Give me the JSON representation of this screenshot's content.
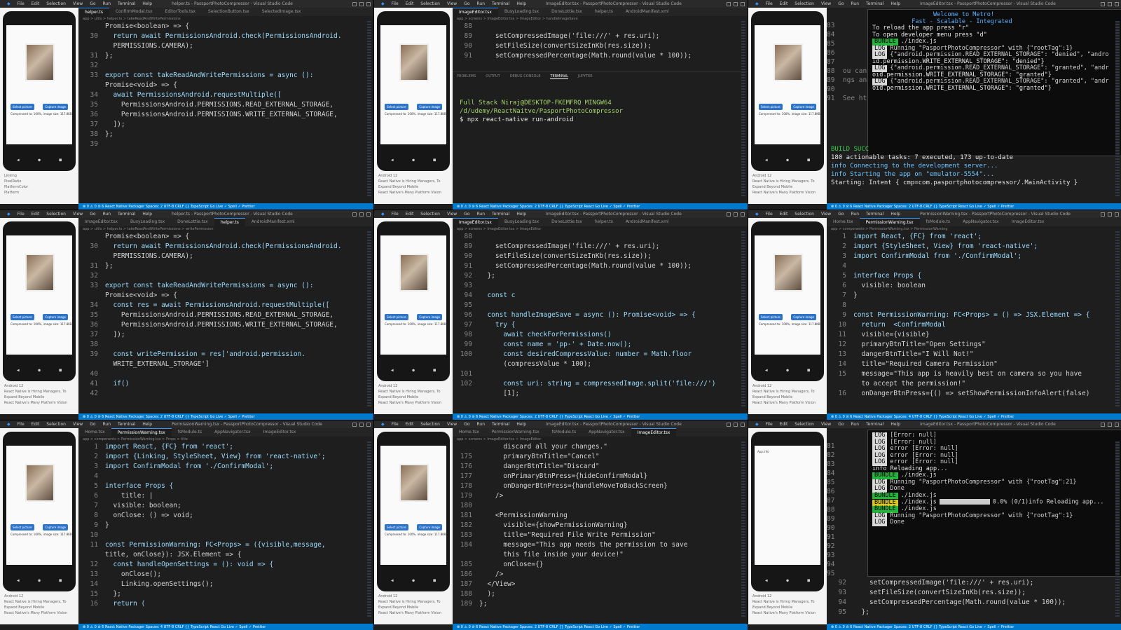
{
  "menu": [
    "File",
    "Edit",
    "Selection",
    "View",
    "Go",
    "Run",
    "Terminal",
    "Help"
  ],
  "phone": {
    "btn_left": "Select picture",
    "btn_right": "Capture image",
    "caption": "Compressed to: 100%, image size: 117.8KB",
    "nav": [
      "◀",
      "●",
      "■"
    ],
    "device_label": "Android 12",
    "notes_a": [
      "Linking",
      "PixelRatio",
      "PlatformColor",
      "Platform"
    ],
    "notes_b": [
      "React Native is Hiring Managers, To",
      "Expand Beyond Mobile",
      "React Native's Many Platform Vision"
    ]
  },
  "panes": [
    {
      "title": "helper.ts - PassportPhotoCompressor - Visual Studio Code",
      "tabs": [
        "helper.ts",
        "ConfirmModal.tsx",
        "EditorTools.tsx",
        "SelectionButton.tsx",
        "SelectedImage.tsx"
      ],
      "active": 0,
      "crumb": "app > utils > helper.ts > takeReadAndWritePermissions",
      "lines": [
        {
          "n": "",
          "t": "Promise<boolean> => {"
        },
        {
          "n": "30",
          "t": "  return await PermissionsAndroid.check(PermissionsAndroid."
        },
        {
          "n": "",
          "t": "  PERMISSIONS.CAMERA);"
        },
        {
          "n": "31",
          "t": "};"
        },
        {
          "n": "32",
          "t": ""
        },
        {
          "n": "33",
          "t": "export const takeReadAndWritePermissions = async ():"
        },
        {
          "n": "",
          "t": "Promise<void> => {"
        },
        {
          "n": "34",
          "t": "  await PermissionsAndroid.requestMultiple(["
        },
        {
          "n": "35",
          "t": "    PermissionsAndroid.PERMISSIONS.READ_EXTERNAL_STORAGE,"
        },
        {
          "n": "36",
          "t": "    PermissionsAndroid.PERMISSIONS.WRITE_EXTERNAL_STORAGE,"
        },
        {
          "n": "37",
          "t": "  ]);"
        },
        {
          "n": "38",
          "t": "};"
        },
        {
          "n": "39",
          "t": ""
        }
      ],
      "status": "⊗ 0 ⚠ 0   ⊘ 6   React Native Packager        Spaces: 2   UTF-8   CRLF   {} TypeScript   Go Live   ✓ Spell   ✓ Prettier"
    },
    {
      "title": "ImageEditor.tsx - PassportPhotoCompressor - Visual Studio Code",
      "tabs": [
        "ImageEditor.tsx",
        "BusyLoading.tsx",
        "DoneLottie.tsx",
        "helper.ts",
        "AndroidManifest.xml"
      ],
      "active": 0,
      "crumb": "app > screens > ImageEditor.tsx > ImageEditor > handleImageSave",
      "lines": [
        {
          "n": "88",
          "t": ""
        },
        {
          "n": "89",
          "t": "    setCompressedImage('file:///' + res.uri);"
        },
        {
          "n": "90",
          "t": "    setFileSize(convertSizeInKb(res.size));"
        },
        {
          "n": "91",
          "t": "    setCompressedPercentage(Math.round(value * 100));"
        }
      ],
      "panel_tabs": [
        "PROBLEMS",
        "OUTPUT",
        "DEBUG CONSOLE",
        "TERMINAL",
        "JUPYTER"
      ],
      "terminal": [
        "Full Stack Niraj@DESKTOP-FKEMFRQ MINGW64 /d/udemy/ReactNaitve/PasportPhotoCompressor",
        "$ npx react-native run-android"
      ],
      "status": "⊗ 0 ⚠ 0   ⊘ 6   React Native Packager        Spaces: 2   UTF-8   CRLF   {} TypeScript React   Go Live   ✓ Spell   ✓ Prettier"
    },
    {
      "title": "ImageEditor.tsx - PassportPhotoCompressor - Visual Studio Code",
      "behind_lines": [
        "83",
        "84",
        "85",
        "86",
        "87",
        "88",
        "89",
        "90",
        "91"
      ],
      "behind_text": [
        "",
        "",
        "",
        "",
        "",
        "ou can us",
        "ngs and m",
        "",
        "See https"
      ],
      "metro": [
        {
          "kind": "text",
          "t": "                 Welcome to Metro!"
        },
        {
          "kind": "text",
          "t": "           Fast - Scalable - Integrated"
        },
        {
          "kind": "text",
          "t": ""
        },
        {
          "kind": "text",
          "t": "To reload the app press \"r\""
        },
        {
          "kind": "text",
          "t": "To open developer menu press \"d\""
        },
        {
          "kind": "bundle",
          "tag": "BUNDLE",
          "t": "./index.js"
        },
        {
          "kind": "log",
          "tag": "LOG",
          "t": "Running \"PasportPhotoCompressor\" with {\"rootTag\":1}"
        },
        {
          "kind": "log",
          "tag": "LOG",
          "t": "{\"android.permission.READ_EXTERNAL_STORAGE\": \"denied\", \"andro"
        },
        {
          "kind": "text",
          "t": "id.permission.WRITE_EXTERNAL_STORAGE\": \"denied\"}"
        },
        {
          "kind": "log",
          "tag": "LOG",
          "t": "{\"android.permission.READ_EXTERNAL_STORAGE\": \"granted\", \"andr"
        },
        {
          "kind": "text",
          "t": "oid.permission.WRITE_EXTERNAL_STORAGE\": \"granted\"}"
        },
        {
          "kind": "log",
          "tag": "LOG",
          "t": "{\"android.permission.READ_EXTERNAL_STORAGE\": \"granted\", \"andr"
        },
        {
          "kind": "text",
          "t": "oid.permission.WRITE_EXTERNAL_STORAGE\": \"granted\"}"
        }
      ],
      "console": [
        "BUILD SUCC",
        "180 actionable tasks: 7 executed, 173 up-to-date",
        "info Connecting to the development server...",
        "info Starting the app on \"emulator-5554\"...",
        "Starting: Intent { cmp=com.pasportphotocompressor/.MainActivity }"
      ],
      "status": "⊗ 0 ⚠ 0   ⊘ 6   React Native Packager        Spaces: 2   UTF-8   CRLF   {} TypeScript React   Go Live   ✓ Spell   ✓ Prettier"
    },
    {
      "title": "helper.ts - PassportPhotoCompressor - Visual Studio Code",
      "tabs": [
        "ImageEditor.tsx",
        "BusyLoading.tsx",
        "DoneLottie.tsx",
        "helper.ts",
        "AndroidManifest.xml"
      ],
      "active": 3,
      "crumb": "app > utils > helper.ts > takeReadAndWritePermissions > writePermission",
      "lines": [
        {
          "n": "",
          "t": "Promise<boolean> => {"
        },
        {
          "n": "30",
          "t": "  return await PermissionsAndroid.check(PermissionsAndroid."
        },
        {
          "n": "",
          "t": "  PERMISSIONS.CAMERA);"
        },
        {
          "n": "31",
          "t": "};"
        },
        {
          "n": "32",
          "t": ""
        },
        {
          "n": "33",
          "t": "export const takeReadAndWritePermissions = async ():"
        },
        {
          "n": "",
          "t": "Promise<void> => {"
        },
        {
          "n": "34",
          "t": "  const res = await PermissionsAndroid.requestMultiple(["
        },
        {
          "n": "35",
          "t": "    PermissionsAndroid.PERMISSIONS.READ_EXTERNAL_STORAGE,"
        },
        {
          "n": "36",
          "t": "    PermissionsAndroid.PERMISSIONS.WRITE_EXTERNAL_STORAGE,"
        },
        {
          "n": "37",
          "t": "  ]);"
        },
        {
          "n": "38",
          "t": ""
        },
        {
          "n": "39",
          "t": "  const writePermission = res['android.permission."
        },
        {
          "n": "",
          "t": "  WRITE_EXTERNAL_STORAGE']"
        },
        {
          "n": "40",
          "t": ""
        },
        {
          "n": "41",
          "t": "  if()"
        },
        {
          "n": "42",
          "t": ""
        }
      ],
      "status": "⊗ 0 ⚠ 0   ⊘ 6   React Native Packager        Spaces: 2   UTF-8   CRLF   {} TypeScript   Go Live   ✓ Spell   ✓ Prettier"
    },
    {
      "title": "ImageEditor.tsx - PassportPhotoCompressor - Visual Studio Code",
      "tabs": [
        "ImageEditor.tsx",
        "BusyLoading.tsx",
        "DoneLottie.tsx",
        "helper.ts",
        "AndroidManifest.xml"
      ],
      "active": 0,
      "crumb": "app > screens > ImageEditor.tsx > ImageEditor",
      "lines": [
        {
          "n": "88",
          "t": ""
        },
        {
          "n": "89",
          "t": "    setCompressedImage('file:///' + res.uri);"
        },
        {
          "n": "90",
          "t": "    setFileSize(convertSizeInKb(res.size));"
        },
        {
          "n": "91",
          "t": "    setCompressedPercentage(Math.round(value * 100));"
        },
        {
          "n": "92",
          "t": "  };"
        },
        {
          "n": "93",
          "t": ""
        },
        {
          "n": "94",
          "t": "  const c"
        },
        {
          "n": "95",
          "t": ""
        },
        {
          "n": "96",
          "t": "  const handleImageSave = async (): Promise<void> => {"
        },
        {
          "n": "97",
          "t": "    try {"
        },
        {
          "n": "98",
          "t": "      await checkForPermissions()"
        },
        {
          "n": "99",
          "t": "      const name = 'pp-' + Date.now();"
        },
        {
          "n": "100",
          "t": "      const desiredCompressValue: number = Math.floor"
        },
        {
          "n": "",
          "t": "      (compressValue * 100);"
        },
        {
          "n": "101",
          "t": ""
        },
        {
          "n": "102",
          "t": "      const uri: string = compressedImage.split('file:///')"
        },
        {
          "n": "",
          "t": "      [1];"
        }
      ],
      "status": "⊗ 0 ⚠ 0   ⊘ 6   React Native Packager        Spaces: 2   UTF-8   CRLF   {} TypeScript React   Go Live   ✓ Spell   ✓ Prettier"
    },
    {
      "title": "PermissionWarning.tsx - PassportPhotoCompressor - Visual Studio Code",
      "tabs": [
        "Home.tsx",
        "PermissionWarning.tsx",
        "fsModule.ts",
        "AppNavigator.tsx",
        "ImageEditor.tsx"
      ],
      "active": 1,
      "crumb": "app > components > PermissionWarning.tsx > PermissionWarning",
      "lines": [
        {
          "n": "1",
          "t": "import React, {FC} from 'react';"
        },
        {
          "n": "2",
          "t": "import {StyleSheet, View} from 'react-native';"
        },
        {
          "n": "3",
          "t": "import ConfirmModal from './ConfirmModal';"
        },
        {
          "n": "4",
          "t": ""
        },
        {
          "n": "5",
          "t": "interface Props {"
        },
        {
          "n": "6",
          "t": "  visible: boolean"
        },
        {
          "n": "7",
          "t": "}"
        },
        {
          "n": "8",
          "t": ""
        },
        {
          "n": "9",
          "t": "const PermissionWarning: FC<Props> = () => JSX.Element => {"
        },
        {
          "n": "10",
          "t": "  return  <ConfirmModal"
        },
        {
          "n": "11",
          "t": "  visible={visible}"
        },
        {
          "n": "12",
          "t": "  primaryBtnTitle=\"Open Settings\""
        },
        {
          "n": "13",
          "t": "  dangerBtnTitle=\"I Will Not!\""
        },
        {
          "n": "14",
          "t": "  title=\"Required Camera Permission\""
        },
        {
          "n": "15",
          "t": "  message=\"This app is heavily best on camera so you have"
        },
        {
          "n": "",
          "t": "  to accept the permission!\""
        },
        {
          "n": "16",
          "t": "  onDangerBtnPress={() => setShowPermissionInfoAlert(false)"
        }
      ],
      "status": "⊗ 0 ⚠ 0   ⊘ 6   React Native Packager        Spaces: 4   UTF-8   CRLF   {} TypeScript React   Go Live   ✓ Spell   ✓ Prettier"
    },
    {
      "title": "PermissionWarning.tsx - PassportPhotoCompressor - Visual Studio Code",
      "tabs": [
        "Home.tsx",
        "PermissionWarning.tsx",
        "fsModule.ts",
        "AppNavigator.tsx",
        "ImageEditor.tsx"
      ],
      "active": 1,
      "crumb": "app > components > PermissionWarning.tsx > Props > title",
      "lines": [
        {
          "n": "1",
          "t": "import React, {FC} from 'react';"
        },
        {
          "n": "2",
          "t": "import {Linking, StyleSheet, View} from 'react-native';"
        },
        {
          "n": "3",
          "t": "import ConfirmModal from './ConfirmModal';"
        },
        {
          "n": "4",
          "t": ""
        },
        {
          "n": "5",
          "t": "interface Props {"
        },
        {
          "n": "6",
          "t": "    title: |"
        },
        {
          "n": "7",
          "t": "  visible: boolean;"
        },
        {
          "n": "8",
          "t": "  onClose: () => void;"
        },
        {
          "n": "9",
          "t": "}"
        },
        {
          "n": "10",
          "t": ""
        },
        {
          "n": "11",
          "t": "const PermissionWarning: FC<Props> = ({visible,message,"
        },
        {
          "n": "",
          "t": "title, onClose}): JSX.Element => {"
        },
        {
          "n": "12",
          "t": "  const handleOpenSettings = (): void => {"
        },
        {
          "n": "13",
          "t": "    onClose();"
        },
        {
          "n": "14",
          "t": "    Linking.openSettings();"
        },
        {
          "n": "15",
          "t": "  };"
        },
        {
          "n": "16",
          "t": "  return ("
        }
      ],
      "status": "⊗ 0 ⚠ 0   ⊘ 6   React Native Packager        Spaces: 4   UTF-8   CRLF   {} TypeScript React   Go Live   ✓ Spell   ✓ Prettier"
    },
    {
      "title": "ImageEditor.tsx - PassportPhotoCompressor - Visual Studio Code",
      "tabs": [
        "Home.tsx",
        "PermissionWarning.tsx",
        "fsModule.ts",
        "AppNavigator.tsx",
        "ImageEditor.tsx"
      ],
      "active": 4,
      "crumb": "app > screens > ImageEditor.tsx > ImageEditor",
      "lines": [
        {
          "n": "",
          "t": "      discard all your changes.\""
        },
        {
          "n": "175",
          "t": "      primaryBtnTitle=\"Cancel\""
        },
        {
          "n": "176",
          "t": "      dangerBtnTitle=\"Discard\""
        },
        {
          "n": "177",
          "t": "      onPrimaryBtnPress={hideConfirmModal}"
        },
        {
          "n": "178",
          "t": "      onDangerBtnPress={handleMoveToBackScreen}"
        },
        {
          "n": "179",
          "t": "    />"
        },
        {
          "n": "180",
          "t": ""
        },
        {
          "n": "181",
          "t": "    <PermissionWarning"
        },
        {
          "n": "182",
          "t": "      visible={showPermissionWarning}"
        },
        {
          "n": "183",
          "t": "      title=\"Required File Write Permission\""
        },
        {
          "n": "184",
          "t": "      message=\"This app needs the permission to save"
        },
        {
          "n": "",
          "t": "      this file inside your device!\""
        },
        {
          "n": "185",
          "t": "      onClose={}"
        },
        {
          "n": "186",
          "t": "    />"
        },
        {
          "n": "187",
          "t": "  </View>"
        },
        {
          "n": "188",
          "t": "  );"
        },
        {
          "n": "189",
          "t": "};"
        }
      ],
      "status": "⊗ 0 ⚠ 0   ⊘ 6   React Native Packager        Spaces: 2   UTF-8   CRLF   {} TypeScript React   Go Live   ✓ Spell   ✓ Prettier"
    },
    {
      "title": "ImageEditor.tsx - PassportPhotoCompressor - Visual Studio Code",
      "phone_app_label": "App.info",
      "metro": [
        {
          "kind": "log",
          "tag": "LOG",
          "t": "[Error: null]"
        },
        {
          "kind": "log",
          "tag": "LOG",
          "t": "[Error: null]"
        },
        {
          "kind": "log",
          "tag": "LOG",
          "t": "error [Error: null]"
        },
        {
          "kind": "log",
          "tag": "LOG",
          "t": "error [Error: null]"
        },
        {
          "kind": "log",
          "tag": "LOG",
          "t": "error [Error: null]"
        },
        {
          "kind": "text",
          "t": "info Reloading app..."
        },
        {
          "kind": "bundle",
          "tag": "BUNDLE",
          "t": "./index.js"
        },
        {
          "kind": "text",
          "t": ""
        },
        {
          "kind": "log",
          "tag": "LOG",
          "t": "Running \"PasportPhotoCompressor\" with {\"rootTag\":21}"
        },
        {
          "kind": "log",
          "tag": "LOG",
          "t": "Done"
        },
        {
          "kind": "bundle",
          "tag": "BUNDLE",
          "t": "./index.js"
        },
        {
          "kind": "text",
          "t": ""
        },
        {
          "kind": "progress",
          "tag": "BUNDLE",
          "t": "./index.js",
          "p": "0.0% (0/1)info Reloading app..."
        },
        {
          "kind": "text",
          "t": ""
        },
        {
          "kind": "bundle",
          "tag": "BUNDLE",
          "t": "./index.js"
        },
        {
          "kind": "text",
          "t": ""
        },
        {
          "kind": "log",
          "tag": "LOG",
          "t": "Running \"PasportPhotoCompressor\" with {\"rootTag\":1}"
        },
        {
          "kind": "log",
          "tag": "LOG",
          "t": "Done"
        }
      ],
      "behind_lines": [
        "81",
        "82",
        "83",
        "84",
        "85",
        "86",
        "87",
        "88",
        "89",
        "90",
        "91",
        "92",
        "93",
        "94",
        "95"
      ],
      "bottom_lines": [
        {
          "n": "92",
          "t": "    setCompressedImage('file:///' + res.uri);"
        },
        {
          "n": "93",
          "t": "    setFileSize(convertSizeInKb(res.size));"
        },
        {
          "n": "94",
          "t": "    setCompressedPercentage(Math.round(value * 100));"
        },
        {
          "n": "95",
          "t": "  };"
        }
      ],
      "status": "⊗ 0 ⚠ 0   ⊘ 6   React Native Packager        Spaces: 2   UTF-8   CRLF   {} TypeScript React   Go Live   ✓ Spell   ✓ Prettier"
    }
  ]
}
